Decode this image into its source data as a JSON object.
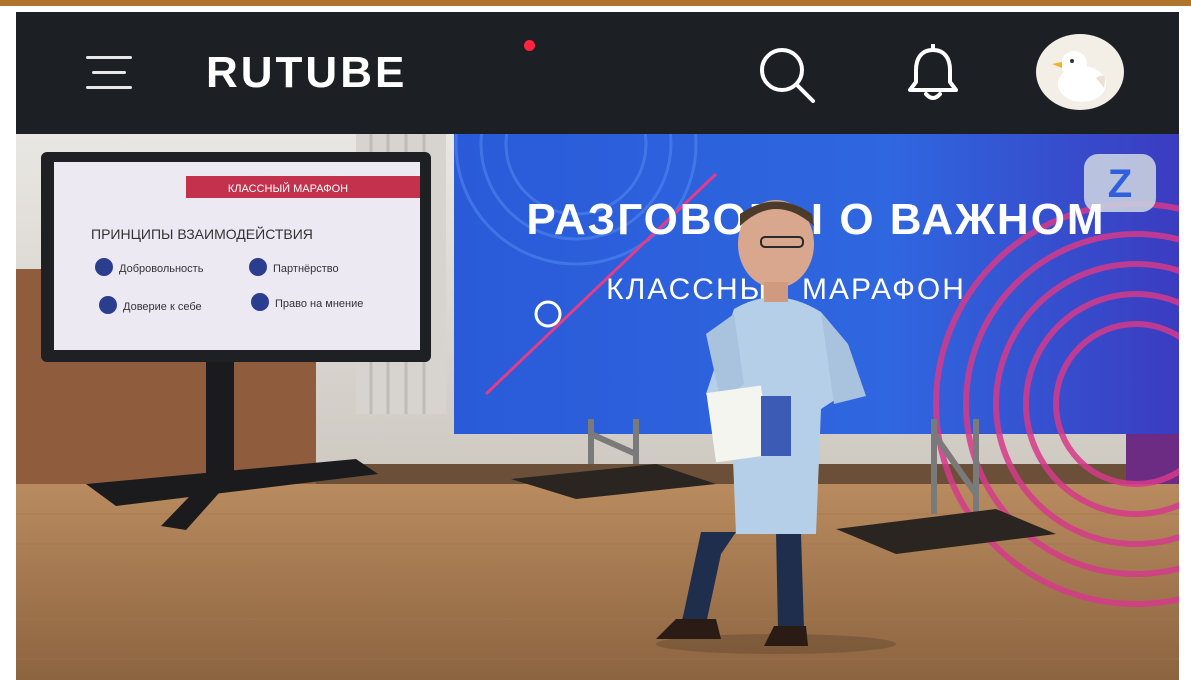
{
  "header": {
    "logo_text": "RUTUBE",
    "icons": {
      "menu": "hamburger-menu-icon",
      "search": "search-icon",
      "notifications": "bell-icon",
      "avatar": "user-avatar"
    }
  },
  "video": {
    "banner_title": "РАЗГОВОРЫ О ВАЖНОМ",
    "banner_subtitle": "КЛАССНЫЙ МАРАФОН",
    "banner_badge": "Z",
    "screen": {
      "header_label": "КЛАССНЫЙ МАРАФОН",
      "title": "ПРИНЦИПЫ ВЗАИМОДЕЙСТВИЯ",
      "items": [
        "Добровольность",
        "Партнёрство",
        "Доверие к себе",
        "Право на мнение"
      ]
    }
  },
  "colors": {
    "topbar_bg": "#1c1f24",
    "frame_border": "#b0752d",
    "logo_dot": "#ff2340",
    "banner_blue": "#2f5fdc",
    "banner_magenta": "#c0368c"
  }
}
